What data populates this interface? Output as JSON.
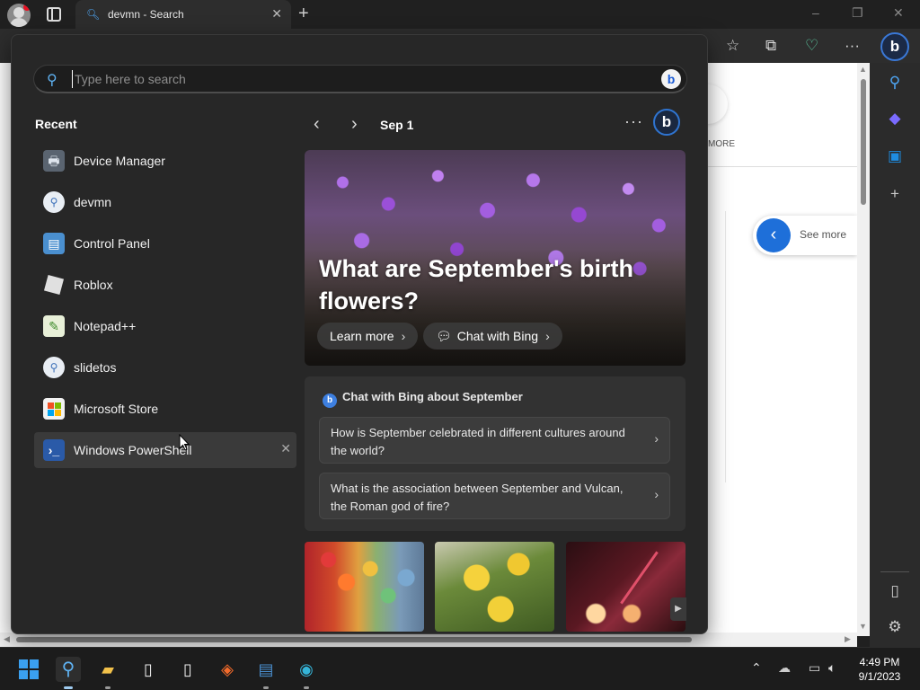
{
  "browser": {
    "tab_title": "devmn - Search",
    "tab_icon": "search-icon",
    "new_tab": "+",
    "window_controls": [
      "–",
      "❐",
      "✕"
    ]
  },
  "page": {
    "more_label": "MORE",
    "see_more": "See more"
  },
  "search": {
    "placeholder": "Type here to search",
    "value": ""
  },
  "recent": {
    "title": "Recent",
    "items": [
      {
        "label": "Device Manager",
        "icon": "device-manager-icon"
      },
      {
        "label": "devmn",
        "icon": "search-icon"
      },
      {
        "label": "Control Panel",
        "icon": "control-panel-icon"
      },
      {
        "label": "Roblox",
        "icon": "roblox-icon"
      },
      {
        "label": "Notepad++",
        "icon": "notepad-plus-plus-icon"
      },
      {
        "label": "slidetos",
        "icon": "search-icon"
      },
      {
        "label": "Microsoft Store",
        "icon": "microsoft-store-icon"
      },
      {
        "label": "Windows PowerShell",
        "icon": "powershell-icon"
      }
    ]
  },
  "highlights": {
    "date": "Sep 1",
    "more": "···",
    "hero_title": "What are September's birth flowers?",
    "learn_more": "Learn more",
    "chat_with_bing": "Chat with Bing",
    "chat_card_title": "Chat with Bing about September",
    "questions": [
      "How is September celebrated in different cultures around the world?",
      "What is the association between September and Vulcan, the Roman god of fire?"
    ]
  },
  "taskbar": {
    "apps": [
      "start",
      "search",
      "file-explorer",
      "file",
      "file",
      "brave",
      "control-panel",
      "edge"
    ],
    "time": "4:49 PM",
    "date": "9/1/2023"
  },
  "colors": {
    "accent": "#3a78d6",
    "panel_bg": "#272727",
    "card_bg": "#323232",
    "search_icon": "#5fb2f2"
  }
}
